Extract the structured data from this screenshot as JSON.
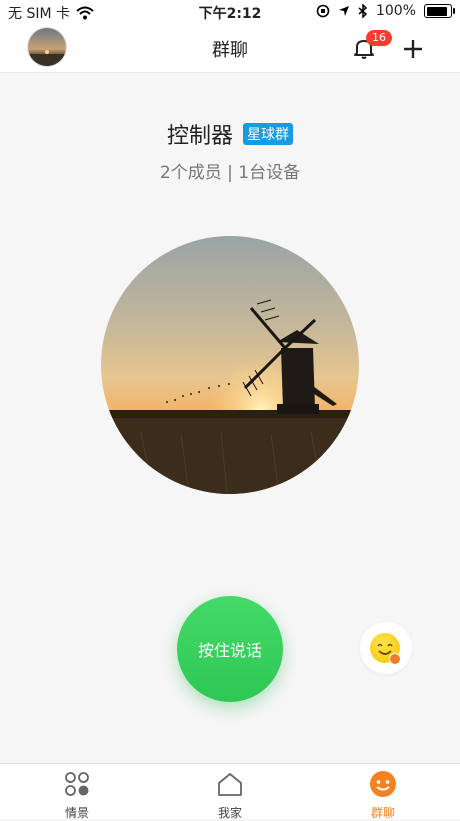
{
  "status_bar": {
    "carrier": "无 SIM 卡",
    "time": "下午2:12",
    "battery": "100%",
    "battery_level": 1.0
  },
  "header": {
    "title": "群聊",
    "notification_count": "16"
  },
  "group": {
    "name": "控制器",
    "tag": "星球群",
    "stats": "2个成员 | 1台设备"
  },
  "actions": {
    "talk_label": "按住说话"
  },
  "tab_bar": {
    "items": [
      {
        "label": "情景",
        "icon": "scenes-icon",
        "active": false
      },
      {
        "label": "我家",
        "icon": "home-icon",
        "active": false
      },
      {
        "label": "群聊",
        "icon": "group-chat-icon",
        "active": true
      }
    ]
  },
  "colors": {
    "accent": "#f58220",
    "talk_button": "#3dd260",
    "badge": "#ff3b30",
    "tag": "#1a9be0"
  }
}
